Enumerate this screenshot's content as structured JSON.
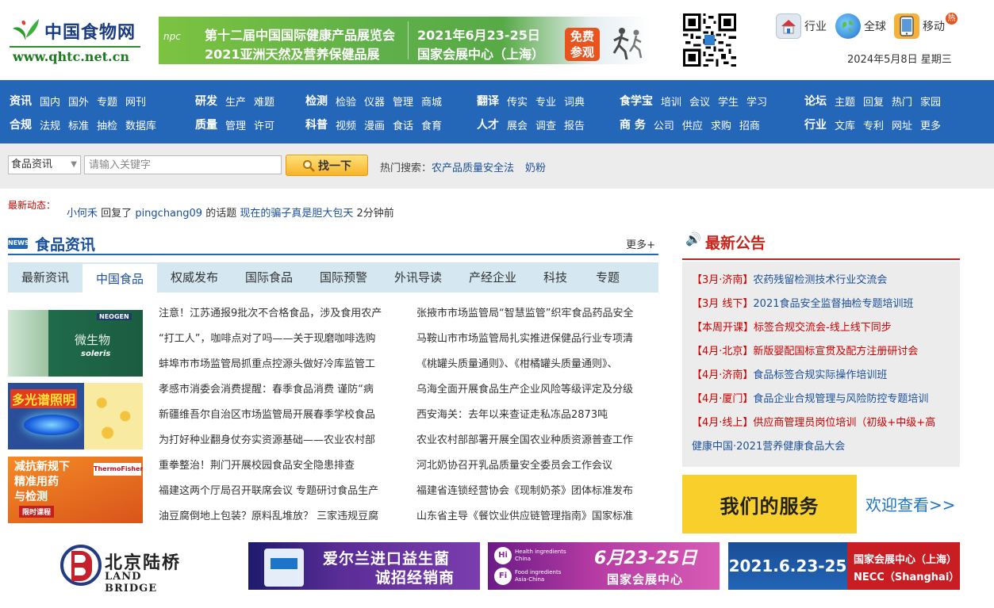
{
  "logo": {
    "name": "中国食物网",
    "url": "www.qhtc.net.cn"
  },
  "top_banner": {
    "line1": "第十二届中国国际健康产品展览会",
    "line2": "2021亚洲天然及营养保健品展",
    "date": "2021年6月23-25日",
    "venue": "国家会展中心（上海）",
    "cta1": "免费",
    "cta2": "参观",
    "npc": "npc"
  },
  "top_links": [
    {
      "label": "行业",
      "icon": "house-icon"
    },
    {
      "label": "全球",
      "icon": "globe-icon"
    },
    {
      "label": "移动",
      "icon": "mobile-icon"
    }
  ],
  "hot_badge": "热",
  "date": "2024年5月8日 星期三",
  "nav": {
    "row1": [
      {
        "head": "资讯",
        "items": [
          "国内",
          "国外",
          "专题",
          "网刊"
        ]
      },
      {
        "head": "研发",
        "items": [
          "生产",
          "难题"
        ]
      },
      {
        "head": "检测",
        "items": [
          "检验",
          "仪器",
          "管理",
          "商城"
        ]
      },
      {
        "head": "翻译",
        "items": [
          "传实",
          "专业",
          "词典"
        ]
      },
      {
        "head": "食学宝",
        "items": [
          "培训",
          "会议",
          "学生",
          "学习"
        ]
      },
      {
        "head": "论坛",
        "items": [
          "主题",
          "回复",
          "热门",
          "家园"
        ]
      }
    ],
    "row2": [
      {
        "head": "合规",
        "items": [
          "法规",
          "标准",
          "抽检",
          "数据库"
        ]
      },
      {
        "head": "质量",
        "items": [
          "管理",
          "许可"
        ]
      },
      {
        "head": "科普",
        "items": [
          "视频",
          "漫画",
          "食话",
          "食育"
        ]
      },
      {
        "head": "人才",
        "items": [
          "展会",
          "调查",
          "报告"
        ]
      },
      {
        "head": "商 务",
        "items": [
          "公司",
          "供应",
          "求购",
          "招商"
        ]
      },
      {
        "head": "行业",
        "items": [
          "文库",
          "专利",
          "网址",
          "更多"
        ]
      }
    ]
  },
  "search": {
    "category": "食品资讯",
    "placeholder": "请输入关键字",
    "button": "找一下",
    "hot_label": "热门搜索：",
    "hot_keywords": [
      "农产品质量安全法",
      "奶粉"
    ]
  },
  "dynamic": {
    "label": "最新动态：",
    "user": "小何禾",
    "action": "回复了",
    "target_user": "pingchang09",
    "suffix": "的话题",
    "topic": "现在的骗子真是胆大包天",
    "time": "2分钟前"
  },
  "food_news": {
    "badge": "NEWS",
    "title": "食品资讯",
    "more": "更多+",
    "tabs": [
      "最新资讯",
      "中国食品",
      "权威发布",
      "国际食品",
      "国际预警",
      "外讯导读",
      "产经企业",
      "科技",
      "专题"
    ],
    "active_tab": "中国食品",
    "thumbs": [
      {
        "t1": "微生物",
        "t2": "soleris",
        "t3": "NEOGEN"
      },
      {
        "t1": "多光谱照明"
      },
      {
        "t1a": "减抗新规下",
        "t1b": "精准用药",
        "t1c": "与检测",
        "tag": "限时课程",
        "brand": "ThermoFisher"
      }
    ],
    "col1": [
      "注意！江苏通报9批次不合格食品，涉及食用农产",
      "“打工人”，咖啡点对了吗——关于现磨咖啡选购",
      "蚌埠市市场监管局抓重点控源头做好冷库监管工",
      "孝感市消委会消费提醒：春季食品消费 谨防“病",
      "新疆维吾尔自治区市场监管局开展春季学校食品",
      "为打好种业翻身仗夯实资源基础——农业农村部",
      "重拳整治！荆门开展校园食品安全隐患排查",
      "福建这两个厅局召开联席会议 专题研讨食品生产",
      "油豆腐倒地上包装？原料乱堆放？ 三家违规豆腐"
    ],
    "col2": [
      "张掖市市场监管局“智慧监管”织牢食品药品安全",
      "马鞍山市市场监管局扎实推进保健品行业专项清",
      "《桃罐头质量通则》、《柑橘罐头质量通则》、",
      "乌海全面开展食品生产企业风险等级评定及分级",
      "西安海关：去年以来查证走私冻品2873吨",
      "农业农村部部署开展全国农业种质资源普查工作",
      "河北奶协召开乳品质量安全委员会工作会议",
      "福建省连锁经营协会《现制奶茶》团体标准发布",
      "山东省主导《餐饮业供应链管理指南》国家标准"
    ]
  },
  "announcements": {
    "title": "最新公告",
    "items": [
      {
        "tag": "【3月·济南】",
        "text": "农药残留检测技术行业交流会",
        "red": false
      },
      {
        "tag": "【3月 线下】",
        "text": "2021食品安全监督抽检专题培训班",
        "red": false
      },
      {
        "tag": "【本周开课】",
        "text": "标签合规交流会-线上线下同步",
        "red": true
      },
      {
        "tag": "【4月·北京】",
        "text": "新版婴配国标宣贯及配方注册研讨会",
        "red": true
      },
      {
        "tag": "【4月·济南】",
        "text": "食品标签合规实际操作培训班",
        "red": false
      },
      {
        "tag": "【4月·厦门】",
        "text": "食品企业合规管理与风险防控专题培训",
        "red": false
      },
      {
        "tag": "【4月·线上】",
        "text": "供应商管理员岗位培训（初级+中级+高",
        "red": true
      },
      {
        "tag": "",
        "text": "健康中国·2021营养健康食品大会",
        "red": false
      }
    ]
  },
  "service": {
    "title": "我们的服务",
    "more": "欢迎查看>>"
  },
  "bottom_banners": {
    "b1": {
      "cn": "北京陆桥",
      "en": "LAND BRIDGE"
    },
    "b2": {
      "t1": "爱尔兰进口益生菌",
      "t2": "诚招经销商"
    },
    "b3": {
      "hi": "Hi",
      "fi": "Fi",
      "sm1a": "Health ingredients",
      "sm1b": "China",
      "sm2a": "Food ingredients",
      "sm2b": "Asia-China",
      "date": "6月23-25日",
      "venue": "国家会展中心"
    },
    "b4": {
      "date": "2021.6.23-25",
      "venue_cn": "国家会展中心（上海）",
      "venue_en": "NECC（Shanghai）"
    }
  }
}
